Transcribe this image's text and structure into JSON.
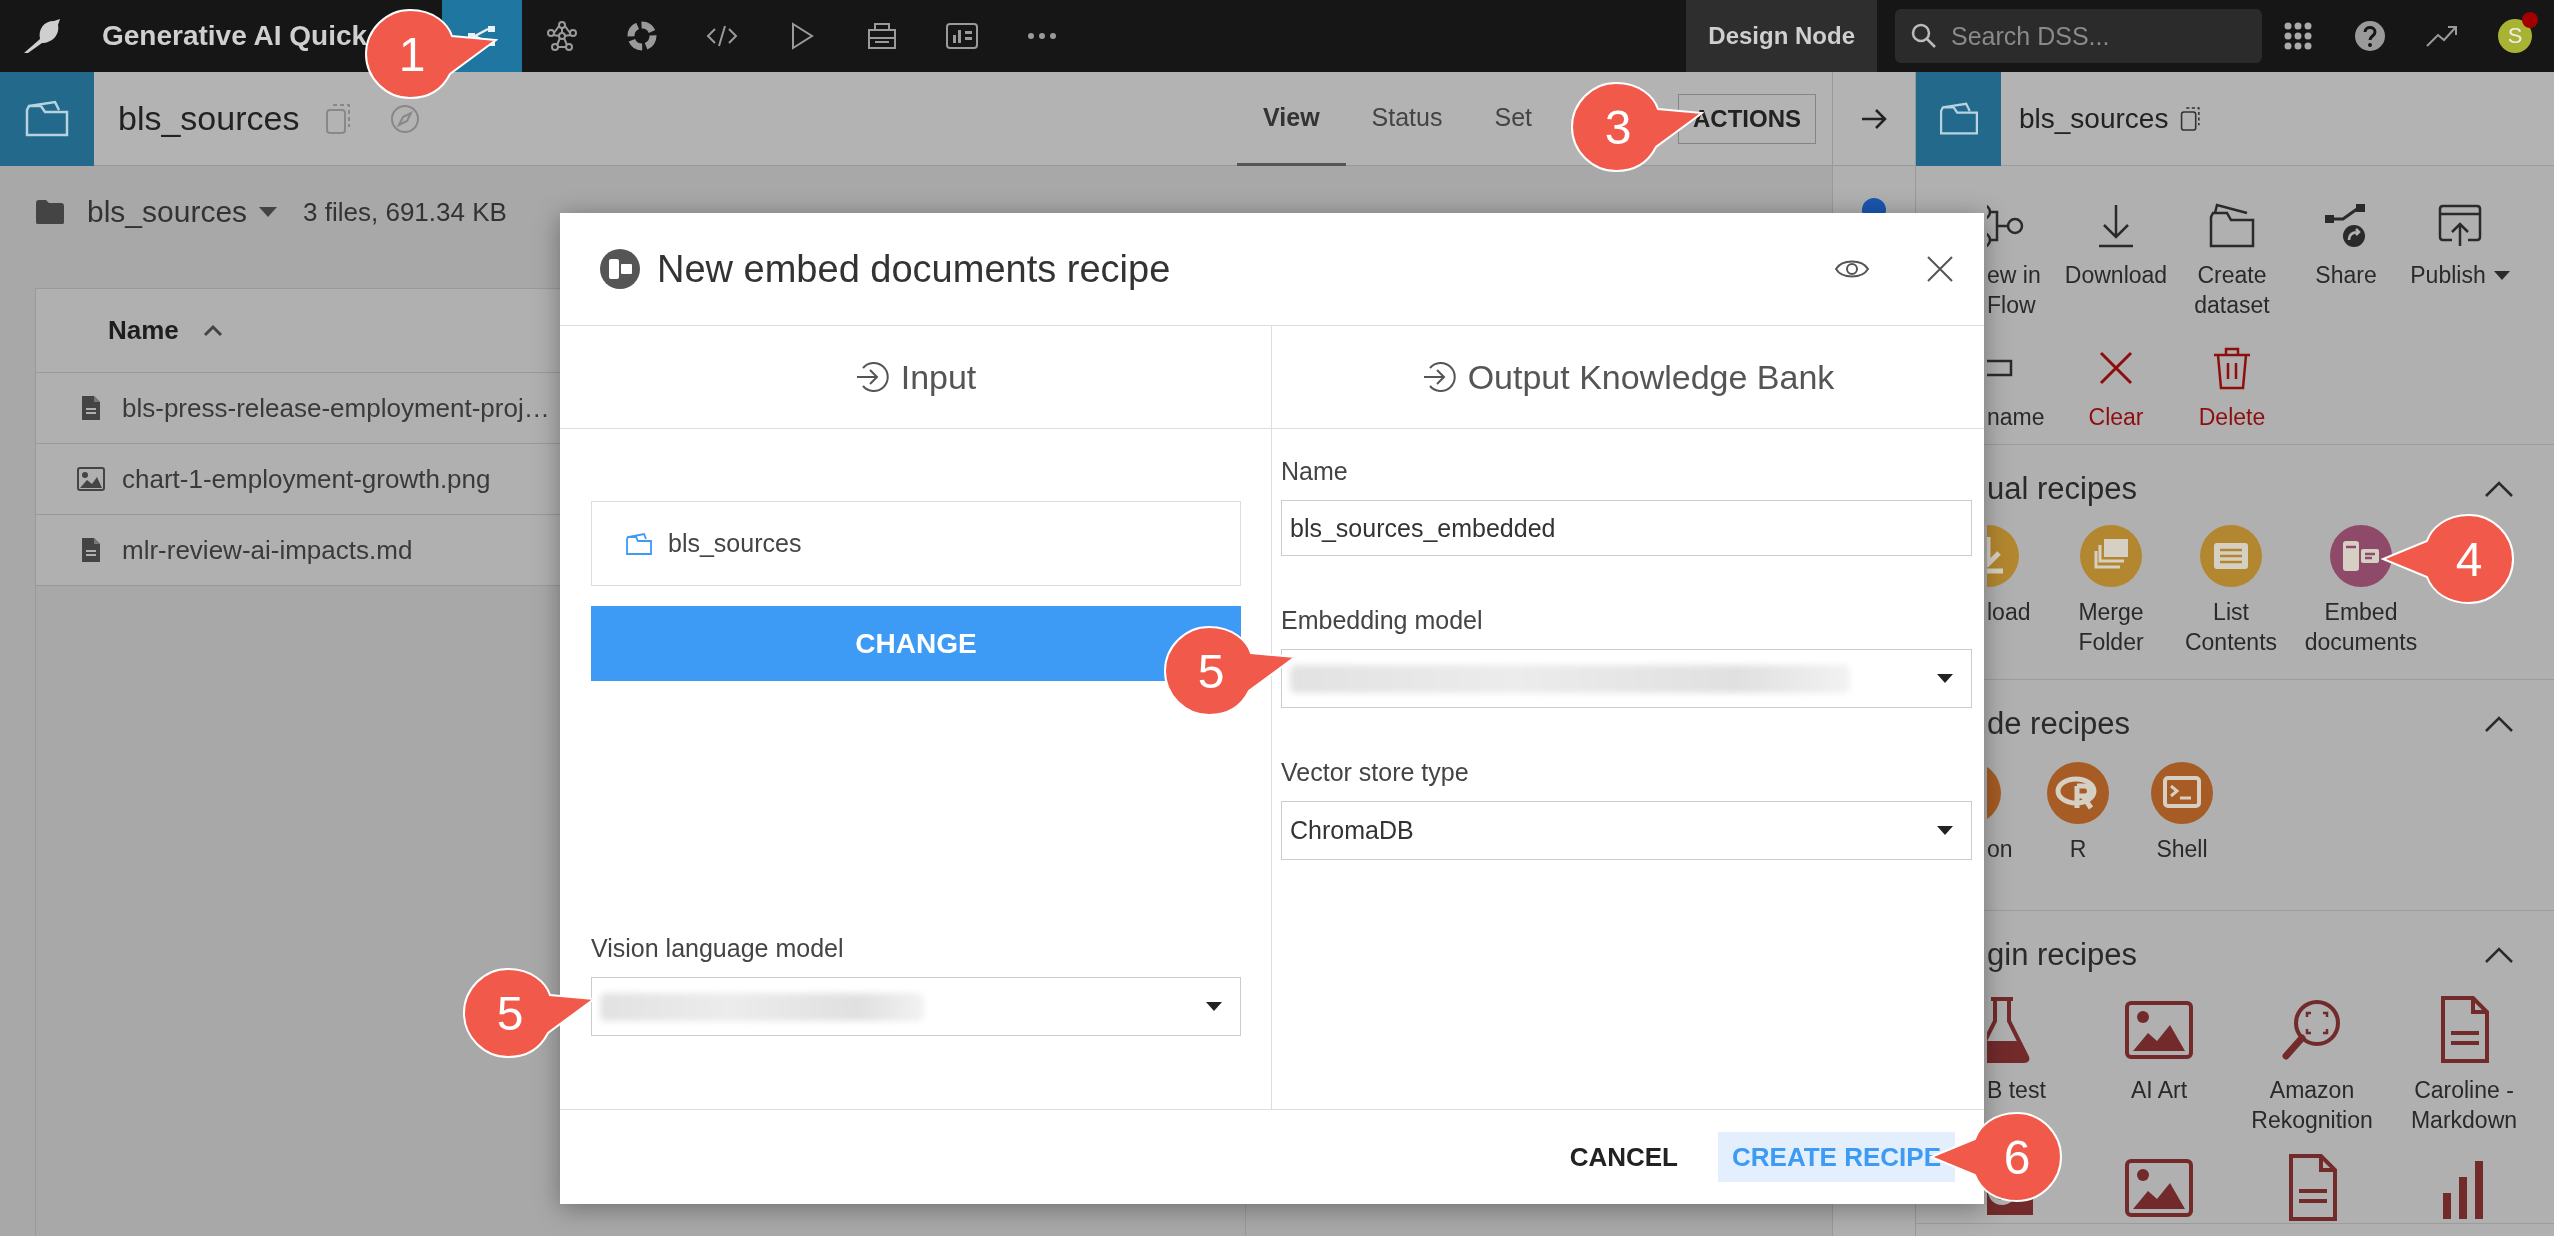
{
  "top_bar": {
    "project_title": "Generative AI Quick",
    "nav_tabs": [
      {
        "kind": "flow",
        "selected": true
      },
      {
        "kind": "network",
        "selected": false
      },
      {
        "kind": "ring",
        "selected": false
      },
      {
        "kind": "code",
        "selected": false
      },
      {
        "kind": "play",
        "selected": false
      },
      {
        "kind": "stack",
        "selected": false
      },
      {
        "kind": "dashboard",
        "selected": false
      },
      {
        "kind": "more",
        "selected": false
      }
    ],
    "node_label": "Design Node",
    "search": {
      "placeholder": "Search DSS..."
    },
    "avatar": {
      "initial": "S",
      "notification": true
    }
  },
  "item_header": {
    "name": "bls_sources",
    "tabs": [
      {
        "label": "View",
        "selected": true
      },
      {
        "label": "Status",
        "selected": false
      },
      {
        "label": "Set",
        "selected": false
      }
    ],
    "actions_button": "ACTIONS"
  },
  "folder_view": {
    "name": "bls_sources",
    "summary": "3 files, 691.34 KB",
    "columns": [
      {
        "label": "Name",
        "sorted_ascending": true
      }
    ],
    "files": [
      {
        "name": "bls-press-release-employment-proj…",
        "kind": "document"
      },
      {
        "name": "chart-1-employment-growth.png",
        "kind": "image"
      },
      {
        "name": "mlr-review-ai-impacts.md",
        "kind": "document"
      }
    ]
  },
  "right_panel": {
    "title": "bls_sources",
    "actions": [
      {
        "label": "ew in Flow",
        "kind": "flow",
        "danger": false
      },
      {
        "label": "Download",
        "kind": "download",
        "danger": false
      },
      {
        "label": "Create dataset",
        "kind": "folder",
        "danger": false
      },
      {
        "label": "Share",
        "kind": "share",
        "danger": false
      },
      {
        "label": "Publish",
        "kind": "publish",
        "danger": false,
        "menu": true
      },
      {
        "label": "name",
        "kind": "rename",
        "danger": false
      },
      {
        "label": "Clear",
        "kind": "clear",
        "danger": true
      },
      {
        "label": "Delete",
        "kind": "delete",
        "danger": true
      }
    ],
    "sections": [
      {
        "title": "ual recipes",
        "expanded": true,
        "items": [
          {
            "label": "load",
            "kind": "download",
            "color": "#b3872f"
          },
          {
            "label": "Merge Folder",
            "kind": "folders",
            "color": "#b3872f"
          },
          {
            "label": "List Contents",
            "kind": "list",
            "color": "#b3872f"
          },
          {
            "label": "Embed documents",
            "kind": "embed",
            "color": "#8f4a6a"
          }
        ]
      },
      {
        "title": "de recipes",
        "expanded": true,
        "items": [
          {
            "label": "on",
            "kind": "python",
            "color": "#a65c24"
          },
          {
            "label": "R",
            "kind": "r",
            "color": "#a65c24"
          },
          {
            "label": "Shell",
            "kind": "shell",
            "color": "#a65c24"
          }
        ]
      },
      {
        "title": "gin recipes",
        "expanded": true,
        "items": [
          {
            "label": "B test",
            "kind": "flask",
            "color": "#722a2a"
          },
          {
            "label": "AI Art",
            "kind": "image",
            "color": "#722a2a"
          },
          {
            "label": "Amazon Rekognition",
            "kind": "scan",
            "color": "#722a2a"
          },
          {
            "label": "Caroline - Markdown",
            "kind": "document",
            "color": "#722a2a"
          },
          {
            "kind": "camera",
            "color": "#722a2a"
          },
          {
            "kind": "image",
            "color": "#722a2a"
          },
          {
            "kind": "document",
            "color": "#722a2a"
          },
          {
            "kind": "chart",
            "color": "#722a2a"
          }
        ]
      }
    ]
  },
  "modal": {
    "title": "New embed documents recipe",
    "input_column": {
      "heading": "Input",
      "input_item": "bls_sources",
      "change_button": "CHANGE",
      "vision_model": {
        "label": "Vision language model",
        "blurred": true
      }
    },
    "output_column": {
      "heading": "Output Knowledge Bank",
      "fields": [
        {
          "label": "Name",
          "kind": "text",
          "value": "bls_sources_embedded"
        },
        {
          "label": "Embedding model",
          "kind": "select",
          "blurred": true
        },
        {
          "label": "Vector store type",
          "kind": "select",
          "value": "ChromaDB"
        }
      ]
    },
    "buttons": [
      {
        "label": "CANCEL",
        "kind": "secondary"
      },
      {
        "label": "CREATE RECIPE",
        "kind": "primary"
      }
    ]
  },
  "callouts": [
    {
      "number": "1",
      "points_left": false
    },
    {
      "number": "3",
      "points_left": false
    },
    {
      "number": "4",
      "points_left": true
    },
    {
      "number": "5",
      "points_left": false
    },
    {
      "number": "5",
      "points_left": false
    },
    {
      "number": "6",
      "points_left": true
    }
  ]
}
